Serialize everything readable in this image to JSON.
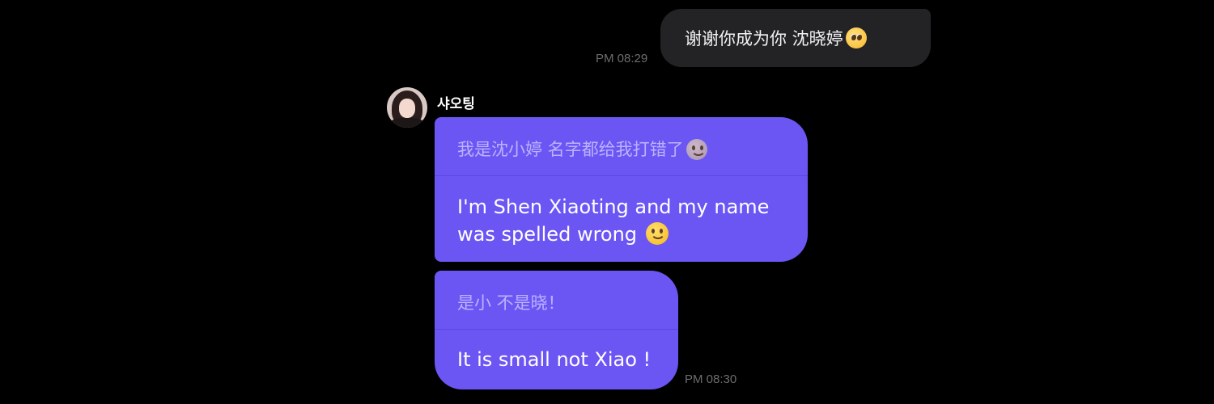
{
  "outgoing": {
    "text": "谢谢你成为你 沈晓婷",
    "emoji": "pleading-face-icon",
    "time": "PM 08:29",
    "bubble_color": "#232326"
  },
  "sender": {
    "name": "샤오팅"
  },
  "incoming": {
    "bubble_color": "#6b56f4",
    "time": "PM 08:30",
    "messages": [
      {
        "original": "我是沈小婷 名字都给我打错了",
        "original_emoji": "slightly-smiling-face-icon",
        "translation_lines": [
          "I'm Shen Xiaoting and my name",
          "was spelled wrong"
        ],
        "translation_emoji": "slightly-smiling-face-icon"
      },
      {
        "original": "是小 不是晓！",
        "translation_lines": [
          "It is small not Xiao !"
        ]
      }
    ]
  }
}
